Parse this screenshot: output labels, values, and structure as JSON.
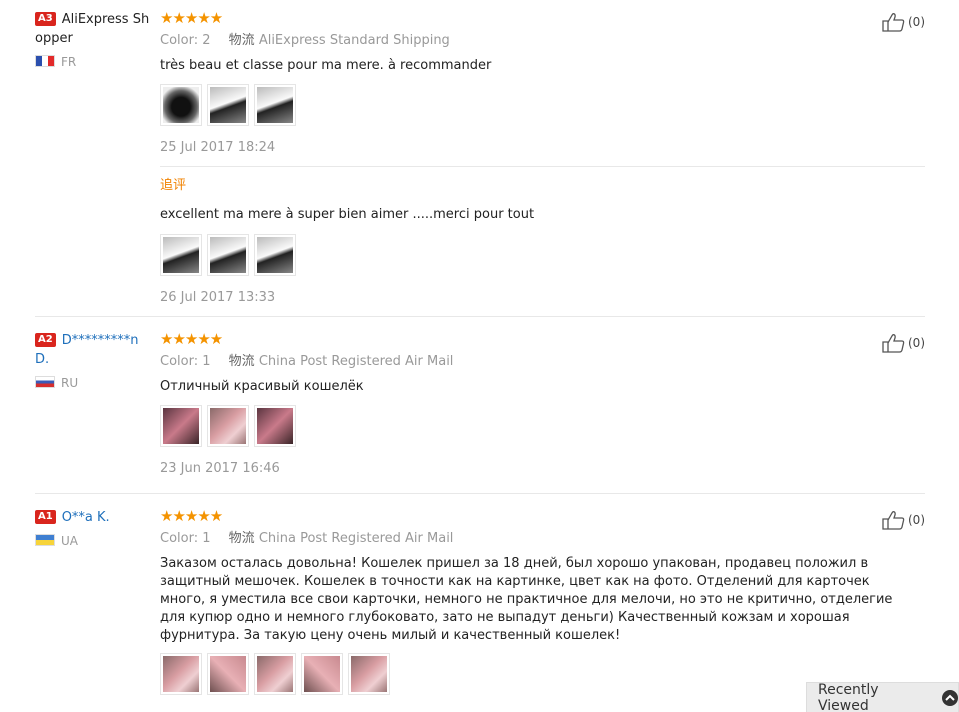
{
  "reviews": [
    {
      "level": "A3",
      "user": "AliExpress Shopper",
      "country": "FR",
      "stars": "★★★★★",
      "color_label": "Color:",
      "color_value": "2",
      "shipping_label": "物流",
      "shipping_value": "AliExpress Standard Shipping",
      "text": "très beau et classe pour ma mere. à recommander",
      "date": "25 Jul 2017 18:24",
      "helpful": "(0)",
      "append": {
        "label": "追评",
        "text": "excellent ma mere à super bien aimer .....merci pour tout",
        "date": "26 Jul 2017 13:33"
      }
    },
    {
      "level": "A2",
      "user": "D*********n D.",
      "country": "RU",
      "stars": "★★★★★",
      "color_label": "Color:",
      "color_value": "1",
      "shipping_label": "物流",
      "shipping_value": "China Post Registered Air Mail",
      "text": "Отличный красивый кошелёк",
      "date": "23 Jun 2017 16:46",
      "helpful": "(0)"
    },
    {
      "level": "A1",
      "user": "O**a K.",
      "country": "UA",
      "stars": "★★★★★",
      "color_label": "Color:",
      "color_value": "1",
      "shipping_label": "物流",
      "shipping_value": "China Post Registered Air Mail",
      "text": "Заказом осталась довольна! Кошелек пришел за 18 дней, был хорошо упакован, продавец положил в защитный мешочек. Кошелек в точности как на картинке, цвет как на фото. Отделений для карточек много, я уместила все свои карточки, немного не практичное для мелочи, но это не критично, отделегие для купюр одно и немного глубоковато, зато не выпадут деньги) Качественный кожзам и хорошая фурнитура. За такую цену очень милый и качественный кошелек!",
      "helpful": "(0)"
    }
  ],
  "recently_viewed": "Recently Viewed",
  "colors": {
    "star": "#f49300",
    "level_badge": "#d9251d",
    "link": "#1e6fbb",
    "append_label": "#f08200"
  }
}
